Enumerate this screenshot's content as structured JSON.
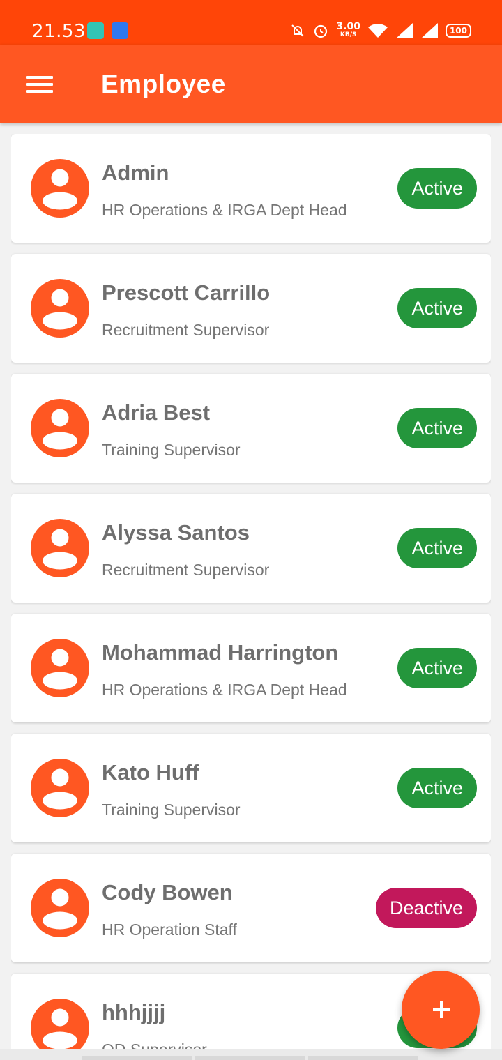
{
  "status_bar": {
    "time": "21.53",
    "net_speed_value": "3.00",
    "net_speed_unit": "KB/S",
    "battery": "100",
    "icons": [
      "teal-app-icon",
      "usb-icon",
      "mute-bell-icon",
      "alarm-icon",
      "wifi-icon",
      "signal-icon",
      "signal-icon",
      "battery-icon"
    ]
  },
  "app_bar": {
    "title": "Employee",
    "menu_icon": "hamburger-menu-icon"
  },
  "colors": {
    "status_bar": "#ff4508",
    "primary": "#ff5722",
    "active": "#24963c",
    "deactive": "#c2185b",
    "name_text": "#6e6e6e"
  },
  "employees": [
    {
      "name": "Admin",
      "role": "HR Operations & IRGA Dept Head",
      "status": "Active"
    },
    {
      "name": "Prescott Carrillo",
      "role": "Recruitment Supervisor",
      "status": "Active"
    },
    {
      "name": "Adria Best",
      "role": "Training Supervisor",
      "status": "Active"
    },
    {
      "name": "Alyssa Santos",
      "role": "Recruitment Supervisor",
      "status": "Active"
    },
    {
      "name": "Mohammad Harrington",
      "role": "HR Operations & IRGA Dept Head",
      "status": "Active"
    },
    {
      "name": "Kato Huff",
      "role": "Training Supervisor",
      "status": "Active"
    },
    {
      "name": "Cody Bowen",
      "role": "HR Operation Staff",
      "status": "Deactive"
    },
    {
      "name": "hhhjjjj",
      "role": "OD Supervisor",
      "status": "Active"
    }
  ],
  "fab": {
    "icon": "plus-icon"
  }
}
